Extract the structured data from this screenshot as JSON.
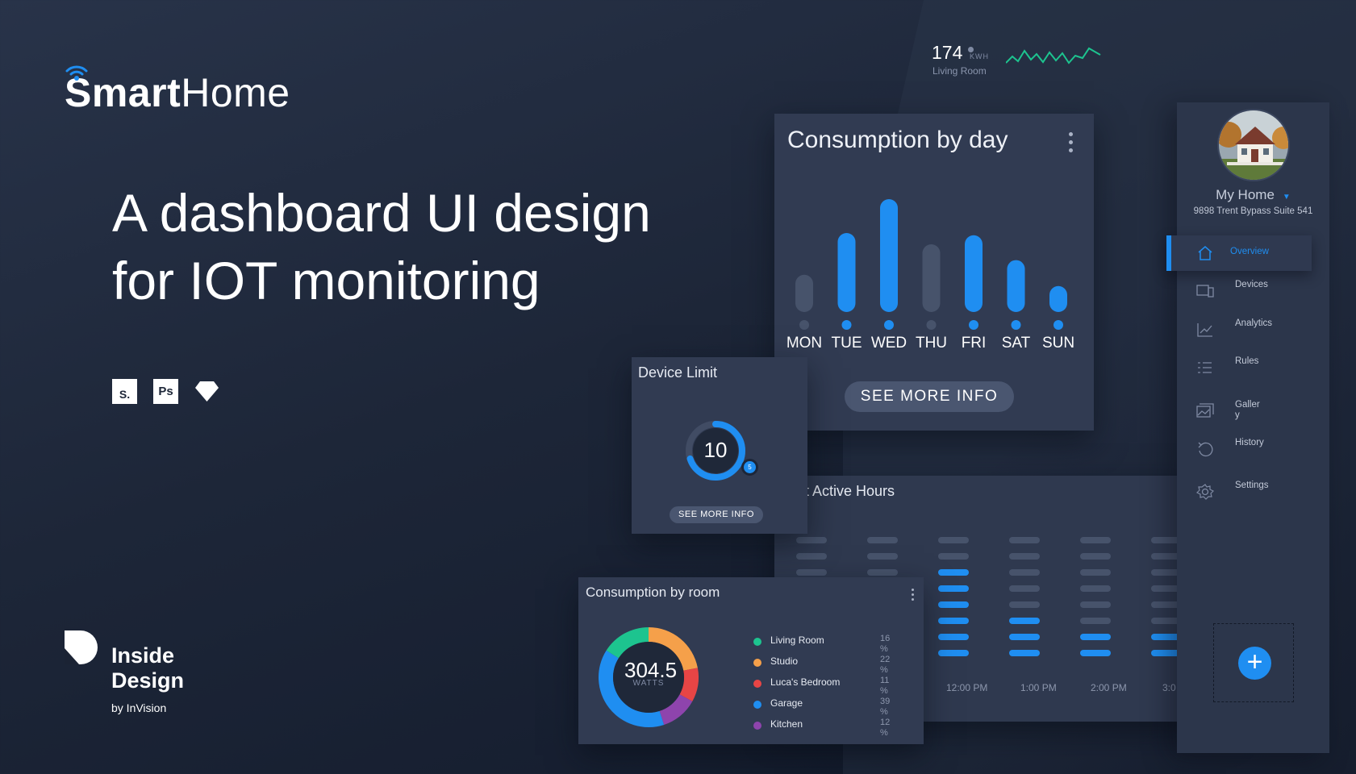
{
  "colors": {
    "accent": "#1f8ef1",
    "bar_inactive": "#47536b",
    "line_green": "#1dc48f",
    "living_room": "#1dc48f",
    "studio": "#f5a04a",
    "lucas_bedroom": "#e84545",
    "garage": "#1f8ef1",
    "kitchen": "#8e44ad"
  },
  "brand": {
    "smart": "Smart",
    "home": "Home",
    "icon": "wifi-icon"
  },
  "headline": {
    "line1": "A dashboard UI design",
    "line2": "for IOT monitoring"
  },
  "tools": {
    "sketch": "S.",
    "photoshop": "Ps",
    "invision_icon": "diamond-icon"
  },
  "inside_design": {
    "title": "Inside Design",
    "by": "by InVision"
  },
  "energy": {
    "value": "174",
    "unit": "KWH",
    "room": "Living Room"
  },
  "consumption_by_day": {
    "title": "Consumption by day",
    "button": "SEE MORE INFO",
    "days": [
      "MON",
      "TUE",
      "WED",
      "THU",
      "FRI",
      "SAT",
      "SUN"
    ],
    "levels": [
      0.33,
      0.7,
      1.0,
      0.6,
      0.68,
      0.46,
      0.23
    ],
    "active": [
      false,
      true,
      true,
      false,
      true,
      true,
      true
    ]
  },
  "device_limit": {
    "title": "Device Limit",
    "value": "10",
    "badge": "5",
    "button": "SEE MORE INFO",
    "fill": 0.7
  },
  "active_hours": {
    "title": "t Active Hours",
    "times": [
      "12:00 PM",
      "1:00 PM",
      "2:00 PM",
      "3:0"
    ]
  },
  "consumption_by_room": {
    "title": "Consumption by room",
    "value": "304.5",
    "unit": "WATTS",
    "rooms": [
      {
        "label": "Living Room",
        "pct": "16%"
      },
      {
        "label": "Studio",
        "pct": "22%"
      },
      {
        "label": "Luca's Bedroom",
        "pct": "11%"
      },
      {
        "label": "Garage",
        "pct": "39%"
      },
      {
        "label": "Kitchen",
        "pct": "12%"
      }
    ]
  },
  "sidebar": {
    "home_name": "My Home",
    "address": "9898 Trent Bypass Suite 541",
    "items": [
      {
        "label": "Overview",
        "icon": "home-icon"
      },
      {
        "label": "Devices",
        "icon": "devices-icon"
      },
      {
        "label": "Analytics",
        "icon": "chart-icon"
      },
      {
        "label": "Rules",
        "icon": "list-icon"
      },
      {
        "label": "Gallery",
        "icon": "gallery-icon"
      },
      {
        "label": "History",
        "icon": "history-icon"
      },
      {
        "label": "Settings",
        "icon": "gear-icon"
      }
    ],
    "add_icon": "plus-icon"
  }
}
